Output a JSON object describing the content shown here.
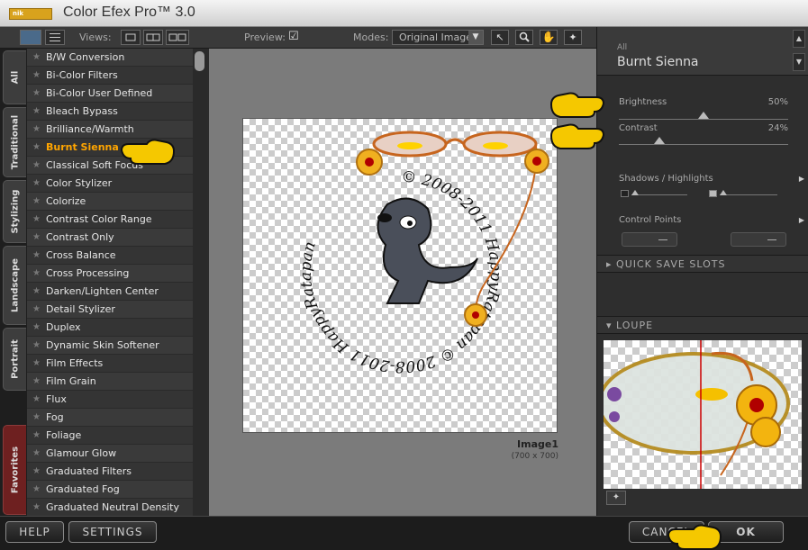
{
  "app": {
    "title": "Color Efex Pro™ 3.0",
    "logo_text": "nik"
  },
  "toolbar": {
    "views_label": "Views:",
    "preview_label": "Preview:",
    "preview_check": "☑",
    "modes_label": "Modes:",
    "mode_value": "Original Image"
  },
  "side_tabs": [
    "All",
    "Traditional",
    "Stylizing",
    "Landscape",
    "Portrait",
    "Favorites"
  ],
  "filters": [
    "B/W Conversion",
    "Bi-Color Filters",
    "Bi-Color User Defined",
    "Bleach Bypass",
    "Brilliance/Warmth",
    "Burnt Sienna",
    "Classical Soft Focus",
    "Color Stylizer",
    "Colorize",
    "Contrast Color Range",
    "Contrast Only",
    "Cross Balance",
    "Cross Processing",
    "Darken/Lighten Center",
    "Detail Stylizer",
    "Duplex",
    "Dynamic Skin Softener",
    "Film Effects",
    "Film Grain",
    "Flux",
    "Fog",
    "Foliage",
    "Glamour Glow",
    "Graduated Filters",
    "Graduated Fog",
    "Graduated Neutral Density"
  ],
  "selected_filter": "Burnt Sienna",
  "preview": {
    "image_name": "Image1",
    "image_size": "(700 x 700)",
    "watermark_text": "© 2008-2011 HappyRatapan © 2008-2011 HappyRatapan"
  },
  "panel": {
    "category": "All",
    "filter_name": "Burnt Sienna",
    "brightness": {
      "label": "Brightness",
      "value_text": "50%",
      "level": 0.5
    },
    "contrast": {
      "label": "Contrast",
      "value_text": "24%",
      "level": 0.24
    },
    "shadows_highlights": "Shadows / Highlights",
    "control_points": "Control Points",
    "quick_save": "QUICK SAVE SLOTS",
    "loupe": "LOUPE"
  },
  "buttons": {
    "help": "HELP",
    "settings": "SETTINGS",
    "cancel": "CANCEL",
    "ok": "OK"
  },
  "colors": {
    "accent": "#ffa500",
    "hand": "#f5c800"
  }
}
